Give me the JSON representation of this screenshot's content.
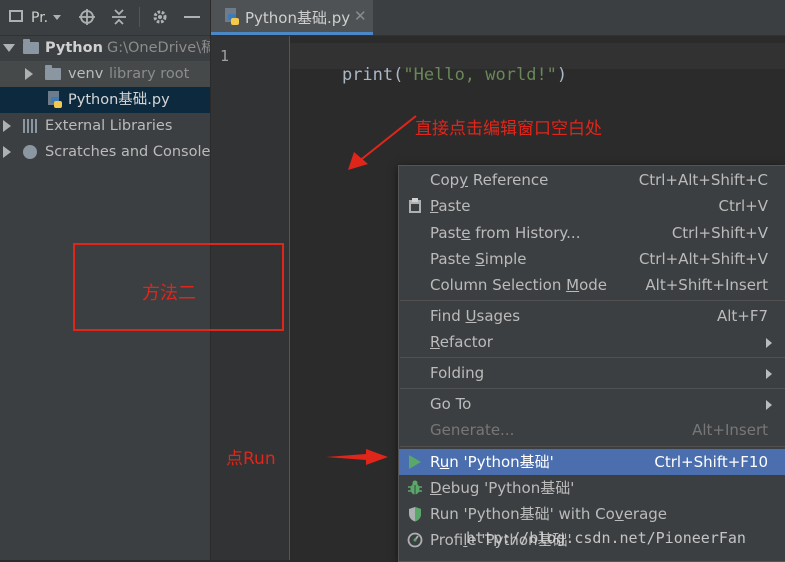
{
  "project_panel": {
    "title": "Pr.",
    "tree": [
      {
        "label": "Python",
        "meta": "G:\\OneDrive\\稿"
      },
      {
        "label": "venv",
        "meta": "library root"
      },
      {
        "label": "Python基础.py"
      },
      {
        "label": "External Libraries"
      },
      {
        "label": "Scratches and Consoles"
      }
    ]
  },
  "editor": {
    "tab_label": "Python基础.py",
    "line_number": "1",
    "code": {
      "fn": "print",
      "open": "(",
      "str": "\"Hello, world!\"",
      "close": ")"
    }
  },
  "context_menu": {
    "items": [
      {
        "pre": "Cop",
        "u": "y",
        "post": " Reference",
        "shortcut": "Ctrl+Alt+Shift+C"
      },
      {
        "pre": "",
        "u": "P",
        "post": "aste",
        "shortcut": "Ctrl+V"
      },
      {
        "pre": "Past",
        "u": "e",
        "post": " from History...",
        "shortcut": "Ctrl+Shift+V"
      },
      {
        "pre": "Paste ",
        "u": "S",
        "post": "imple",
        "shortcut": "Ctrl+Alt+Shift+V"
      },
      {
        "pre": "Column Selection ",
        "u": "M",
        "post": "ode",
        "shortcut": "Alt+Shift+Insert"
      },
      {
        "pre": "Find ",
        "u": "U",
        "post": "sages",
        "shortcut": "Alt+F7"
      },
      {
        "pre": "",
        "u": "R",
        "post": "efactor",
        "shortcut": ""
      },
      {
        "pre": "Folding",
        "u": "",
        "post": "",
        "shortcut": ""
      },
      {
        "pre": "Go To",
        "u": "",
        "post": "",
        "shortcut": ""
      },
      {
        "pre": "Generate...",
        "u": "",
        "post": "",
        "shortcut": "Alt+Insert"
      },
      {
        "pre": "R",
        "u": "u",
        "post": "n 'Python基础'",
        "shortcut": "Ctrl+Shift+F10"
      },
      {
        "pre": "",
        "u": "D",
        "post": "ebug 'Python基础'",
        "shortcut": ""
      },
      {
        "pre": "Run 'Python基础' with Co",
        "u": "v",
        "post": "erage",
        "shortcut": ""
      },
      {
        "pre": "Profi",
        "u": "l",
        "post": "e 'Python基础'",
        "shortcut": ""
      }
    ]
  },
  "annotations": {
    "click_edit": "直接点击编辑窗口空白处",
    "method_two": "方法二",
    "click_run": "点Run"
  },
  "watermark": "http://blog.csdn.net/PioneerFan",
  "colors": {
    "accent": "#4b6eaf",
    "annotation": "#e0261b",
    "string": "#6a8759"
  }
}
